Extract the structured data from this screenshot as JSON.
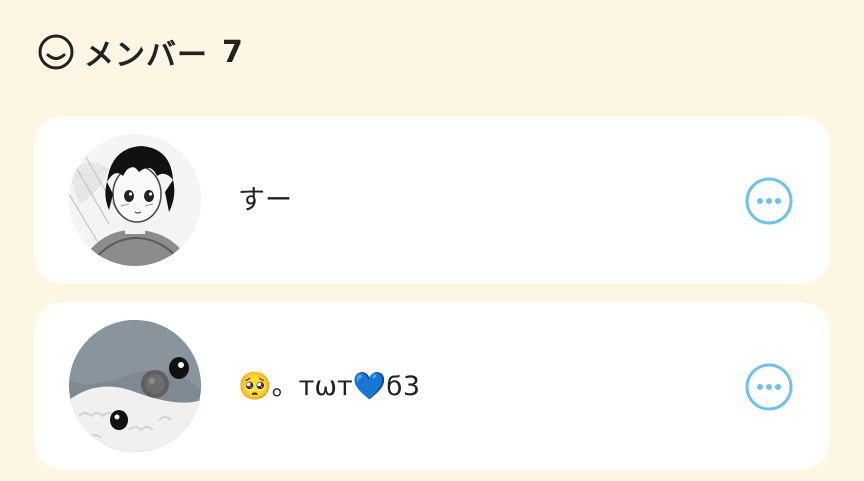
{
  "header": {
    "icon": "smile-face-icon",
    "title": "メンバー",
    "count": "7"
  },
  "members": [
    {
      "name": "すー",
      "avatar_icon": "manga-boy-avatar",
      "more_icon": "more-options-icon"
    },
    {
      "name": "🥺。ᴛѡᴛ💙ϭ3",
      "avatar_icon": "penguin-plush-avatar",
      "more_icon": "more-options-icon"
    }
  ],
  "colors": {
    "background": "#fdf6e3",
    "card": "#ffffff",
    "accent": "#6ec3ea",
    "text": "#222222"
  }
}
